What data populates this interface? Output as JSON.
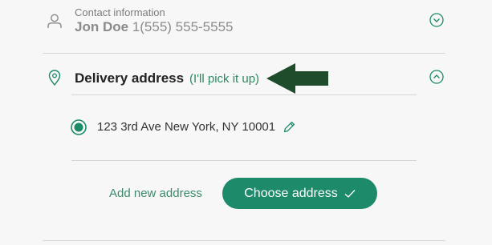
{
  "contact": {
    "section_label": "Contact information",
    "name": "Jon Doe",
    "phone": "1(555) 555-5555"
  },
  "delivery": {
    "title": "Delivery address",
    "hint": "(I'll pick it up)"
  },
  "address": {
    "selected": true,
    "text": "123 3rd Ave New York, NY 10001"
  },
  "actions": {
    "add_new_label": "Add new address",
    "choose_label": "Choose address"
  },
  "icons": {
    "contact": "person-icon",
    "delivery": "map-pin-icon",
    "edit": "pencil-icon",
    "expand": "chevron-down-icon",
    "collapse": "chevron-up-icon",
    "confirm": "check-icon",
    "annotation": "arrow-left-icon"
  },
  "colors": {
    "accent": "#1d8a6a",
    "text_dark": "#222222",
    "text_muted": "#8b8b8b",
    "annotation_arrow": "#1f4d2b"
  }
}
